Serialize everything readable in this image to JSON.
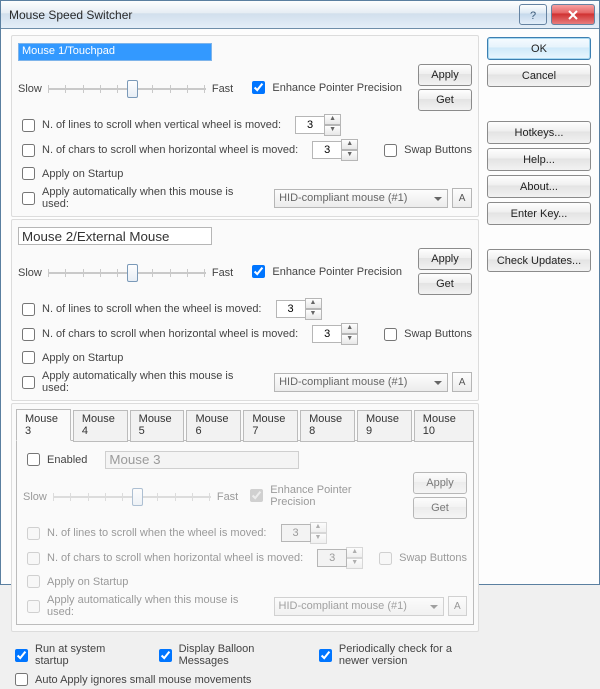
{
  "window": {
    "title": "Mouse Speed Switcher"
  },
  "buttons": {
    "ok": "OK",
    "cancel": "Cancel",
    "hotkeys": "Hotkeys...",
    "help": "Help...",
    "about": "About...",
    "enterKey": "Enter Key...",
    "checkUpdates": "Check Updates...",
    "apply": "Apply",
    "get": "Get",
    "a": "A"
  },
  "labels": {
    "slow": "Slow",
    "fast": "Fast",
    "enhance": "Enhance Pointer Precision",
    "swap": "Swap Buttons",
    "linesVertical": "N. of lines to scroll when vertical wheel is moved:",
    "linesWheel": "N. of lines to scroll when the wheel is moved:",
    "charsHoriz": "N. of chars to scroll when  horizontal wheel is moved:",
    "applyStartup": "Apply on Startup",
    "applyAuto": "Apply automatically when this mouse is used:",
    "enabled": "Enabled",
    "runStartup": "Run at system startup",
    "balloon": "Display Balloon Messages",
    "periodic": "Periodically check for a newer version",
    "autoApplyIgnore": "Auto Apply ignores small mouse movements"
  },
  "mouse1": {
    "name": "Mouse 1/Touchpad",
    "enhance": true,
    "lines": "3",
    "chars": "3",
    "swap": false,
    "applyStartup": false,
    "applyAuto": false,
    "device": "HID-compliant mouse (#1)"
  },
  "mouse2": {
    "name": "Mouse 2/External Mouse",
    "enhance": true,
    "lines": "3",
    "chars": "3",
    "swap": false,
    "applyStartup": false,
    "applyAuto": false,
    "device": "HID-compliant mouse (#1)"
  },
  "tabs": [
    "Mouse 3",
    "Mouse 4",
    "Mouse 5",
    "Mouse 6",
    "Mouse 7",
    "Mouse 8",
    "Mouse 9",
    "Mouse 10"
  ],
  "mouse3": {
    "enabled": false,
    "name": "Mouse 3",
    "enhance": true,
    "lines": "3",
    "chars": "3",
    "swap": false,
    "applyStartup": false,
    "applyAuto": false,
    "device": "HID-compliant mouse (#1)"
  },
  "footer": {
    "runStartup": true,
    "balloon": true,
    "periodic": true,
    "autoApplyIgnore": false
  }
}
